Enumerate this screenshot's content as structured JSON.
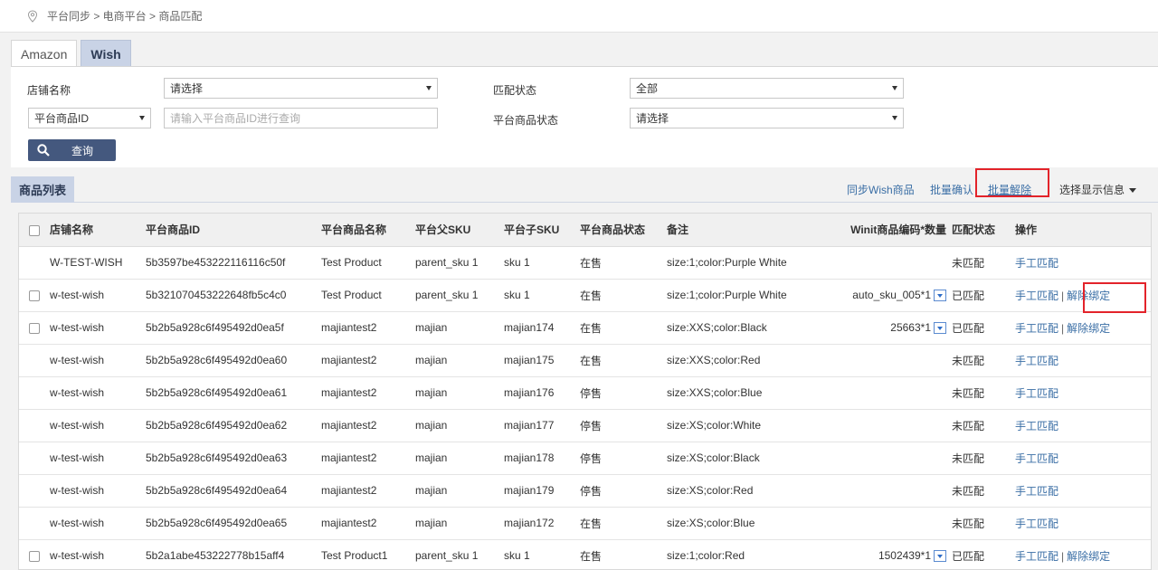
{
  "breadcrumb": {
    "text": "平台同步 > 电商平台 > 商品匹配"
  },
  "tabs": [
    {
      "label": "Amazon",
      "active": false
    },
    {
      "label": "Wish",
      "active": true
    }
  ],
  "filter": {
    "shop_label": "店铺名称",
    "shop_value": "请选择",
    "match_status_label": "匹配状态",
    "match_status_value": "全部",
    "id_type_value": "平台商品ID",
    "id_placeholder": "请输入平台商品ID进行查询",
    "product_status_label": "平台商品状态",
    "product_status_value": "请选择",
    "query_label": "查询"
  },
  "list": {
    "tab_label": "商品列表",
    "actions": {
      "sync": "同步Wish商品",
      "batch_confirm": "批量确认",
      "batch_unbind": "批量解除",
      "display_info": "选择显示信息"
    }
  },
  "table": {
    "headers": [
      "店铺名称",
      "平台商品ID",
      "平台商品名称",
      "平台父SKU",
      "平台子SKU",
      "平台商品状态",
      "备注",
      "Winit商品编码*数量",
      "匹配状态",
      "操作"
    ],
    "rows": [
      {
        "has_checkbox": false,
        "shop": "W-TEST-WISH",
        "id": "5b3597be453222116116c50f",
        "name": "Test Product",
        "parent_sku": "parent_sku 1",
        "child_sku": "sku 1",
        "status": "在售",
        "note": "size:1;color:Purple White",
        "winit": "",
        "match": "未匹配",
        "op1": "手工匹配",
        "op2": ""
      },
      {
        "has_checkbox": true,
        "shop": "w-test-wish",
        "id": "5b321070453222648fb5c4c0",
        "name": "Test Product",
        "parent_sku": "parent_sku 1",
        "child_sku": "sku 1",
        "status": "在售",
        "note": "size:1;color:Purple White",
        "winit": "auto_sku_005*1",
        "match": "已匹配",
        "op1": "手工匹配",
        "op2": "解除绑定"
      },
      {
        "has_checkbox": true,
        "shop": "w-test-wish",
        "id": "5b2b5a928c6f495492d0ea5f",
        "name": "majiantest2",
        "parent_sku": "majian",
        "child_sku": "majian174",
        "status": "在售",
        "note": "size:XXS;color:Black",
        "winit": "25663*1",
        "match": "已匹配",
        "op1": "手工匹配",
        "op2": "解除绑定"
      },
      {
        "has_checkbox": false,
        "shop": "w-test-wish",
        "id": "5b2b5a928c6f495492d0ea60",
        "name": "majiantest2",
        "parent_sku": "majian",
        "child_sku": "majian175",
        "status": "在售",
        "note": "size:XXS;color:Red",
        "winit": "",
        "match": "未匹配",
        "op1": "手工匹配",
        "op2": ""
      },
      {
        "has_checkbox": false,
        "shop": "w-test-wish",
        "id": "5b2b5a928c6f495492d0ea61",
        "name": "majiantest2",
        "parent_sku": "majian",
        "child_sku": "majian176",
        "status": "停售",
        "note": "size:XXS;color:Blue",
        "winit": "",
        "match": "未匹配",
        "op1": "手工匹配",
        "op2": ""
      },
      {
        "has_checkbox": false,
        "shop": "w-test-wish",
        "id": "5b2b5a928c6f495492d0ea62",
        "name": "majiantest2",
        "parent_sku": "majian",
        "child_sku": "majian177",
        "status": "停售",
        "note": "size:XS;color:White",
        "winit": "",
        "match": "未匹配",
        "op1": "手工匹配",
        "op2": ""
      },
      {
        "has_checkbox": false,
        "shop": "w-test-wish",
        "id": "5b2b5a928c6f495492d0ea63",
        "name": "majiantest2",
        "parent_sku": "majian",
        "child_sku": "majian178",
        "status": "停售",
        "note": "size:XS;color:Black",
        "winit": "",
        "match": "未匹配",
        "op1": "手工匹配",
        "op2": ""
      },
      {
        "has_checkbox": false,
        "shop": "w-test-wish",
        "id": "5b2b5a928c6f495492d0ea64",
        "name": "majiantest2",
        "parent_sku": "majian",
        "child_sku": "majian179",
        "status": "停售",
        "note": "size:XS;color:Red",
        "winit": "",
        "match": "未匹配",
        "op1": "手工匹配",
        "op2": ""
      },
      {
        "has_checkbox": false,
        "shop": "w-test-wish",
        "id": "5b2b5a928c6f495492d0ea65",
        "name": "majiantest2",
        "parent_sku": "majian",
        "child_sku": "majian172",
        "status": "在售",
        "note": "size:XS;color:Blue",
        "winit": "",
        "match": "未匹配",
        "op1": "手工匹配",
        "op2": ""
      },
      {
        "has_checkbox": true,
        "shop": "w-test-wish",
        "id": "5b2a1abe453222778b15aff4",
        "name": "Test Product1",
        "parent_sku": "parent_sku 1",
        "child_sku": "sku 1",
        "status": "在售",
        "note": "size:1;color:Red",
        "winit": "1502439*1",
        "match": "已匹配",
        "op1": "手工匹配",
        "op2": "解除绑定"
      }
    ]
  },
  "colors": {
    "accent": "#44587e",
    "link": "#3a6ea5",
    "tab_active": "#c9d3e6",
    "highlight": "#e3232a"
  }
}
